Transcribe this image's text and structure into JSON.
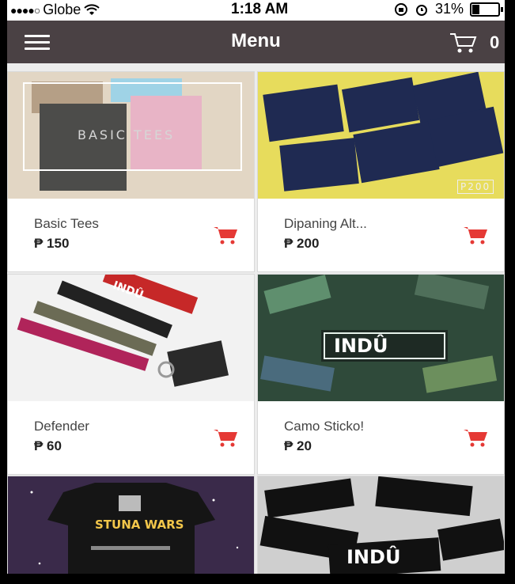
{
  "status_bar": {
    "carrier": "Globe",
    "time": "1:18 AM",
    "battery": "31%"
  },
  "navbar": {
    "title": "Menu",
    "cart_count": "0"
  },
  "products": [
    {
      "name": "Basic Tees",
      "price": "₱ 150",
      "image_text": "BASIC TEES"
    },
    {
      "name": "Dipaning Alt...",
      "price": "₱ 200",
      "image_text": "P200"
    },
    {
      "name": "Defender",
      "price": "₱ 60",
      "image_text": "INDÛ"
    },
    {
      "name": "Camo Sticko!",
      "price": "₱ 20",
      "image_text": "INDÛ"
    },
    {
      "name": "",
      "price": "",
      "image_text": "STUNA WARS"
    },
    {
      "name": "",
      "price": "",
      "image_text": "INDÛ"
    }
  ],
  "colors": {
    "navbar": "#4a4144",
    "cart_icon": "#e53935"
  },
  "icons": {
    "menu": "hamburger-icon",
    "cart": "cart-icon",
    "add_to_cart": "cart-icon"
  }
}
